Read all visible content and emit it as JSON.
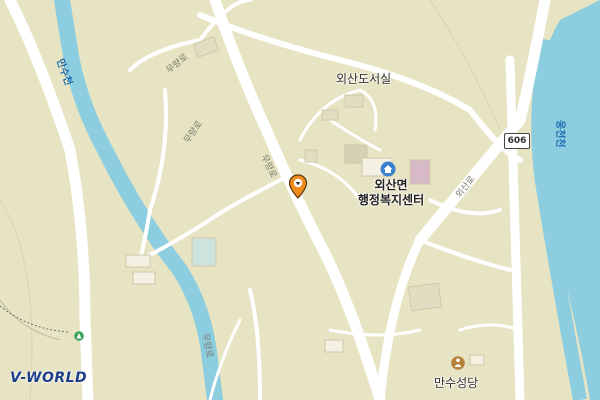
{
  "map": {
    "background": "#e7e4c3",
    "water_color": "#8ccee0",
    "road_color": "#ffffff",
    "labels": {
      "library": "외산도서실",
      "office_line1": "외산면",
      "office_line2": "행정복지센터",
      "church": "만수성당",
      "river_left": "만수천",
      "river_right": "웅천천",
      "road_1": "무량로",
      "road_2": "무량로",
      "road_3": "무량로",
      "road_4": "외산로",
      "road_5": "무량로",
      "route_number": "606"
    },
    "icons": {
      "office": "home-icon",
      "church": "church-icon",
      "marker": "location-pin-icon",
      "bus": "bus-stop-icon"
    }
  },
  "brand": {
    "logo_text": "V-WORLD"
  }
}
